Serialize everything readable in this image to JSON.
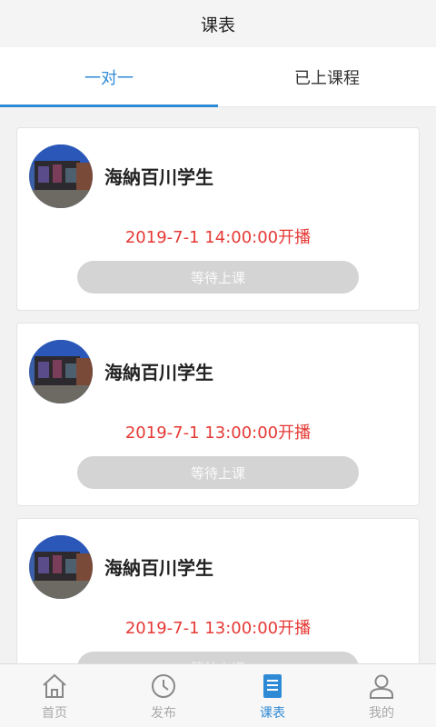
{
  "header": {
    "title": "课表"
  },
  "tabs": [
    {
      "label": "一对一",
      "active": true
    },
    {
      "label": "已上课程",
      "active": false
    }
  ],
  "courses": [
    {
      "name": "海納百川学生",
      "time": "2019-7-1 14:00:00开播",
      "button": "等待上课"
    },
    {
      "name": "海納百川学生",
      "time": "2019-7-1 13:00:00开播",
      "button": "等待上课"
    },
    {
      "name": "海納百川学生",
      "time": "2019-7-1 13:00:00开播",
      "button": "等待上课"
    }
  ],
  "tabbar": [
    {
      "label": "首页",
      "icon": "home-icon",
      "active": false
    },
    {
      "label": "发布",
      "icon": "clock-icon",
      "active": false
    },
    {
      "label": "课表",
      "icon": "schedule-icon",
      "active": true
    },
    {
      "label": "我的",
      "icon": "user-icon",
      "active": false
    }
  ],
  "colors": {
    "accent": "#2f8ad6",
    "time_red": "#e53935",
    "button_gray": "#d4d4d4"
  }
}
